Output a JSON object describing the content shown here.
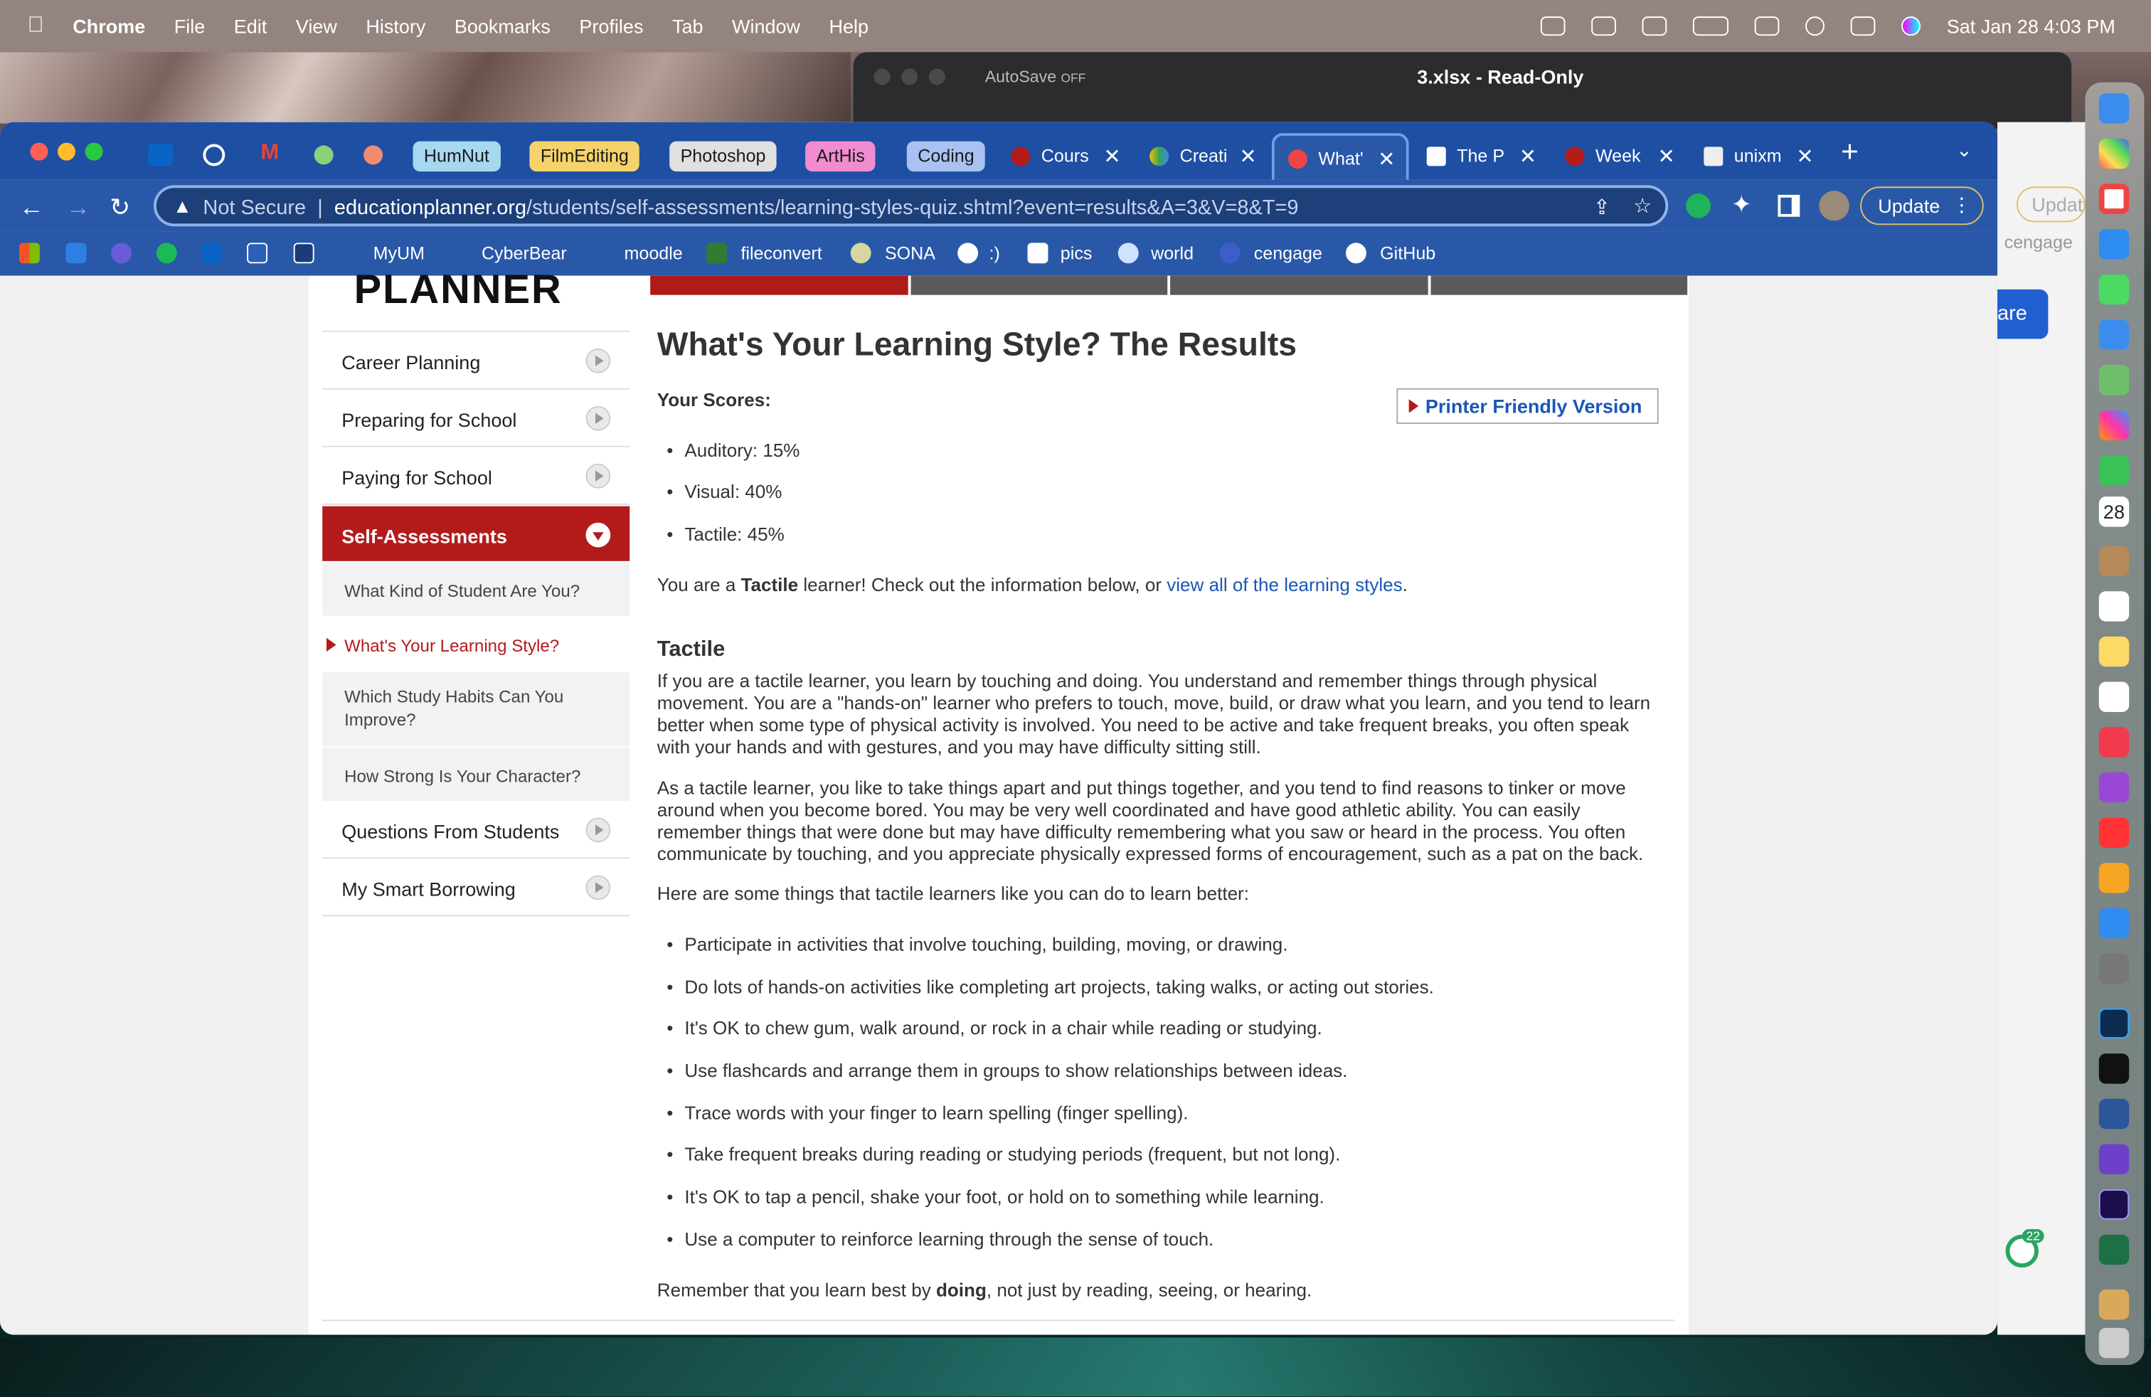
{
  "menubar": {
    "app": "Chrome",
    "items": [
      "File",
      "Edit",
      "View",
      "History",
      "Bookmarks",
      "Profiles",
      "Tab",
      "Window",
      "Help"
    ],
    "clock": "Sat Jan 28  4:03 PM"
  },
  "excel": {
    "autosave": "AutoSave",
    "toggle": "OFF",
    "title": "3.xlsx  -  Read-Only"
  },
  "tabs": {
    "groups": [
      {
        "label": "HumNut",
        "color": "#a6d8f0"
      },
      {
        "label": "FilmEditing",
        "color": "#f6d36a"
      },
      {
        "label": "Photoshop",
        "color": "#e0e0e0"
      },
      {
        "label": "ArtHis",
        "color": "#f08ccf"
      },
      {
        "label": "Coding",
        "color": "#a9c2f2"
      }
    ],
    "open": [
      "Cours",
      "Creati",
      "What'",
      "The P",
      "Week",
      "unixm"
    ],
    "active_index": 2
  },
  "address": {
    "security": "Not Secure",
    "host": "educationplanner.org",
    "path": "/students/self-assessments/learning-styles-quiz.shtml?event=results&A=3&V=8&T=9",
    "update": "Update"
  },
  "bookmarks": [
    "MyUM",
    "CyberBear",
    "moodle",
    "fileconvert",
    "SONA",
    ":)",
    "pics",
    "world",
    "cengage",
    "GitHub"
  ],
  "sidebar": {
    "items": [
      "Career Planning",
      "Preparing for School",
      "Paying for School"
    ],
    "active": "Self-Assessments",
    "subitems": [
      "What Kind of Student Are You?",
      "What's Your Learning Style?",
      "Which Study Habits Can You Improve?",
      "How Strong Is Your Character?"
    ],
    "after": [
      "Questions From Students",
      "My Smart Borrowing"
    ]
  },
  "main": {
    "title": "What's Your Learning Style? The Results",
    "scores_label": "Your Scores:",
    "printer": "Printer Friendly Version",
    "scores": [
      "Auditory: 15%",
      "Visual: 40%",
      "Tactile: 45%"
    ],
    "result_pre": "You are a ",
    "result_bold": "Tactile",
    "result_mid": " learner! Check out the information below, or ",
    "result_link": "view all of the learning styles",
    "result_end": ".",
    "section": "Tactile",
    "p1": "If you are a tactile learner, you learn by touching and doing. You understand and remember things through physical movement. You are a \"hands-on\" learner who prefers to touch, move, build, or draw what you learn, and you tend to learn better when some type of physical activity is involved. You need to be active and take frequent breaks, you often speak with your hands and with gestures, and you may have difficulty sitting still.",
    "p2": "As a tactile learner, you like to take things apart and put things together, and you tend to find reasons to tinker or move around when you become bored. You may be very well coordinated and have good athletic ability. You can easily remember things that were done but may have difficulty remembering what you saw or heard in the process. You often communicate by touching, and you appreciate physically expressed forms of encouragement, such as a pat on the back.",
    "tips_intro": "Here are some things that tactile learners like you can do to learn better:",
    "tips": [
      "Participate in activities that involve touching, building, moving, or drawing.",
      "Do lots of hands-on activities like completing art projects, taking walks, or acting out stories.",
      "It's OK to chew gum, walk around, or rock in a chair while reading or studying.",
      "Use flashcards and arrange them in groups to show relationships between ideas.",
      "Trace words with your finger to learn spelling (finger spelling).",
      "Take frequent breaks during reading or studying periods (frequent, but not long).",
      "It's OK to tap a pencil, shake your foot, or hold on to something while learning.",
      "Use a computer to reinforce learning through the sense of touch."
    ],
    "closing_pre": "Remember that you learn best by ",
    "closing_bold": "doing",
    "closing_end": ", not just by reading, seeing, or hearing."
  },
  "right": {
    "share": "are",
    "update": "Updat",
    "cengage": "cengage",
    "badge": "22"
  },
  "dock_date": "28"
}
